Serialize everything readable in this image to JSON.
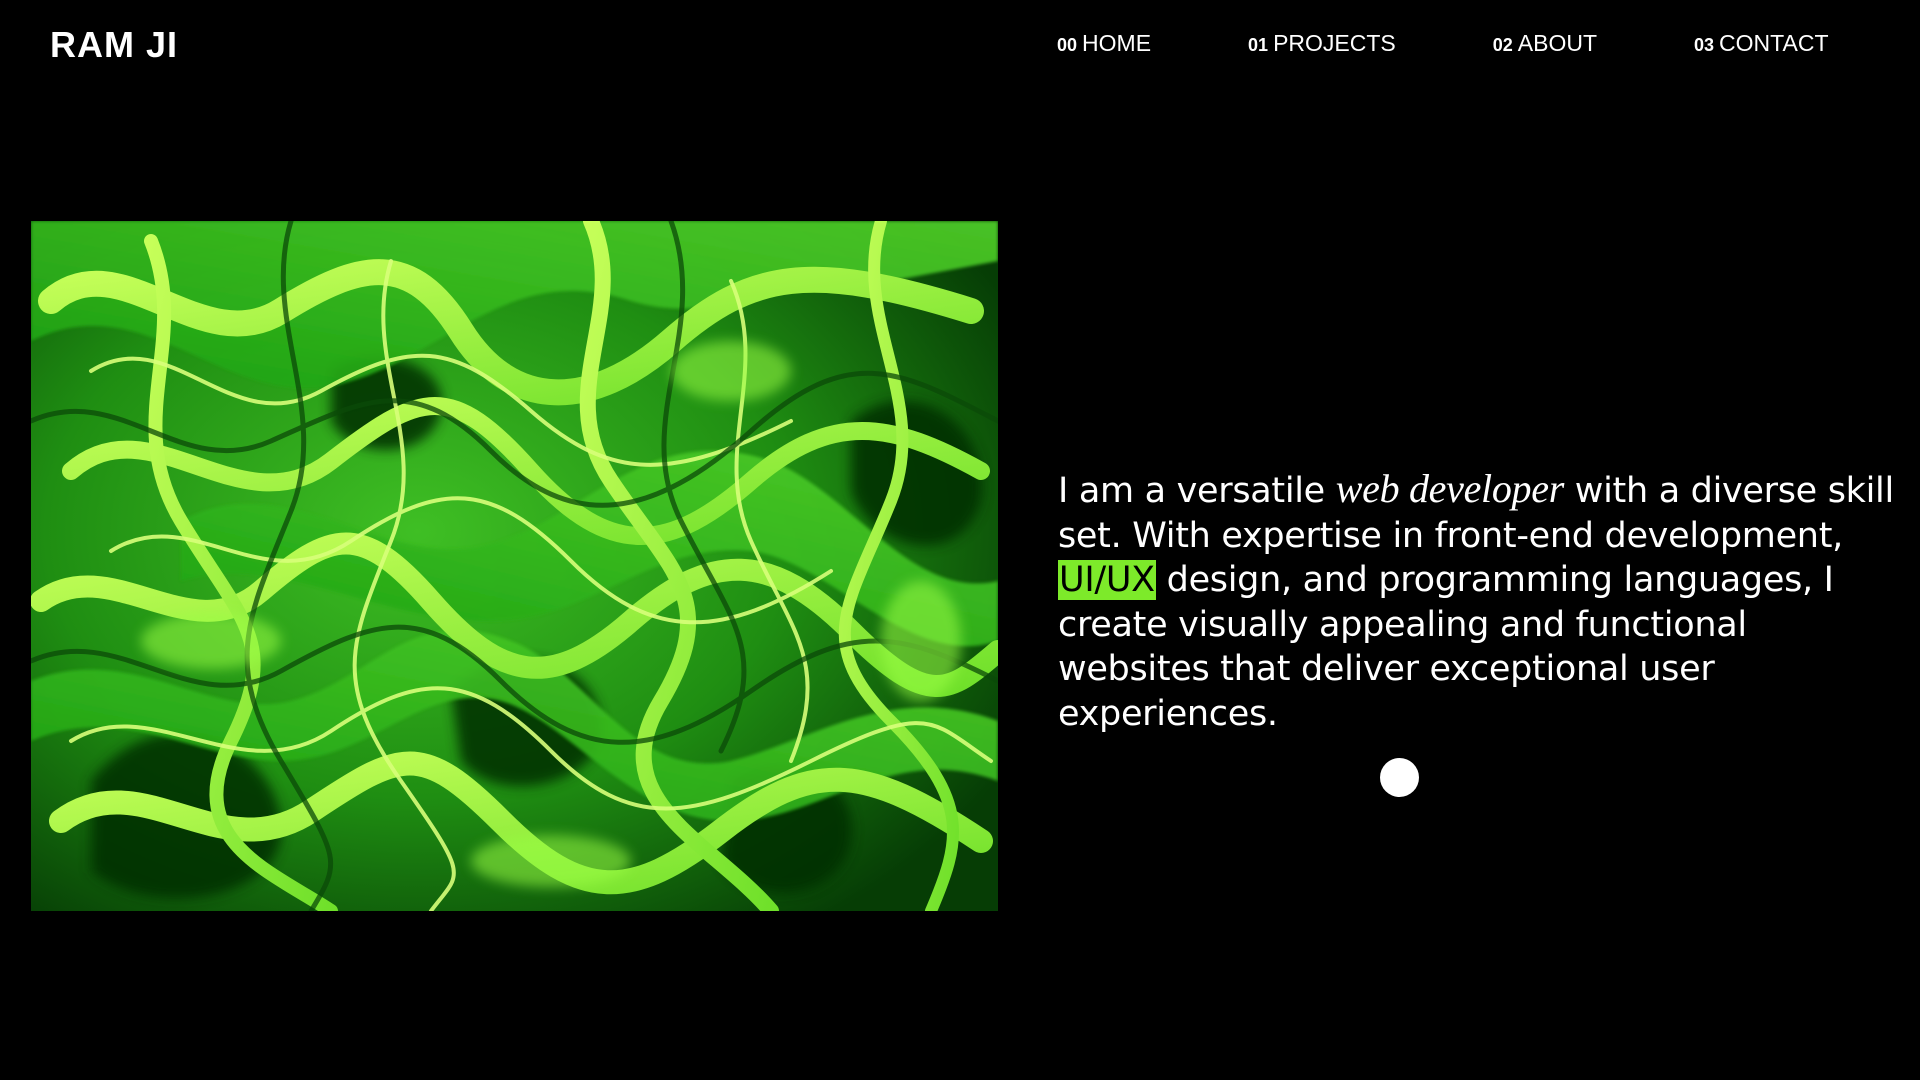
{
  "header": {
    "logo": "RAM JI",
    "nav": [
      {
        "num": "00",
        "label": "HOME"
      },
      {
        "num": "01",
        "label": "PROJECTS"
      },
      {
        "num": "02",
        "label": "ABOUT"
      },
      {
        "num": "03",
        "label": "CONTACT"
      }
    ]
  },
  "hero": {
    "image_description_icon": "abstract-green-swirl-image",
    "intro": {
      "part1": "I am a versatile ",
      "emphasis": "web developer",
      "part2": " with a diverse skill set. With expertise in front-end development, ",
      "highlight": "UI/UX",
      "part3": " design, and programming languages, I create visually appealing and functional websites that deliver exceptional user experiences."
    }
  },
  "colors": {
    "background": "#000000",
    "text": "#ffffff",
    "accent": "#7dea2a"
  }
}
